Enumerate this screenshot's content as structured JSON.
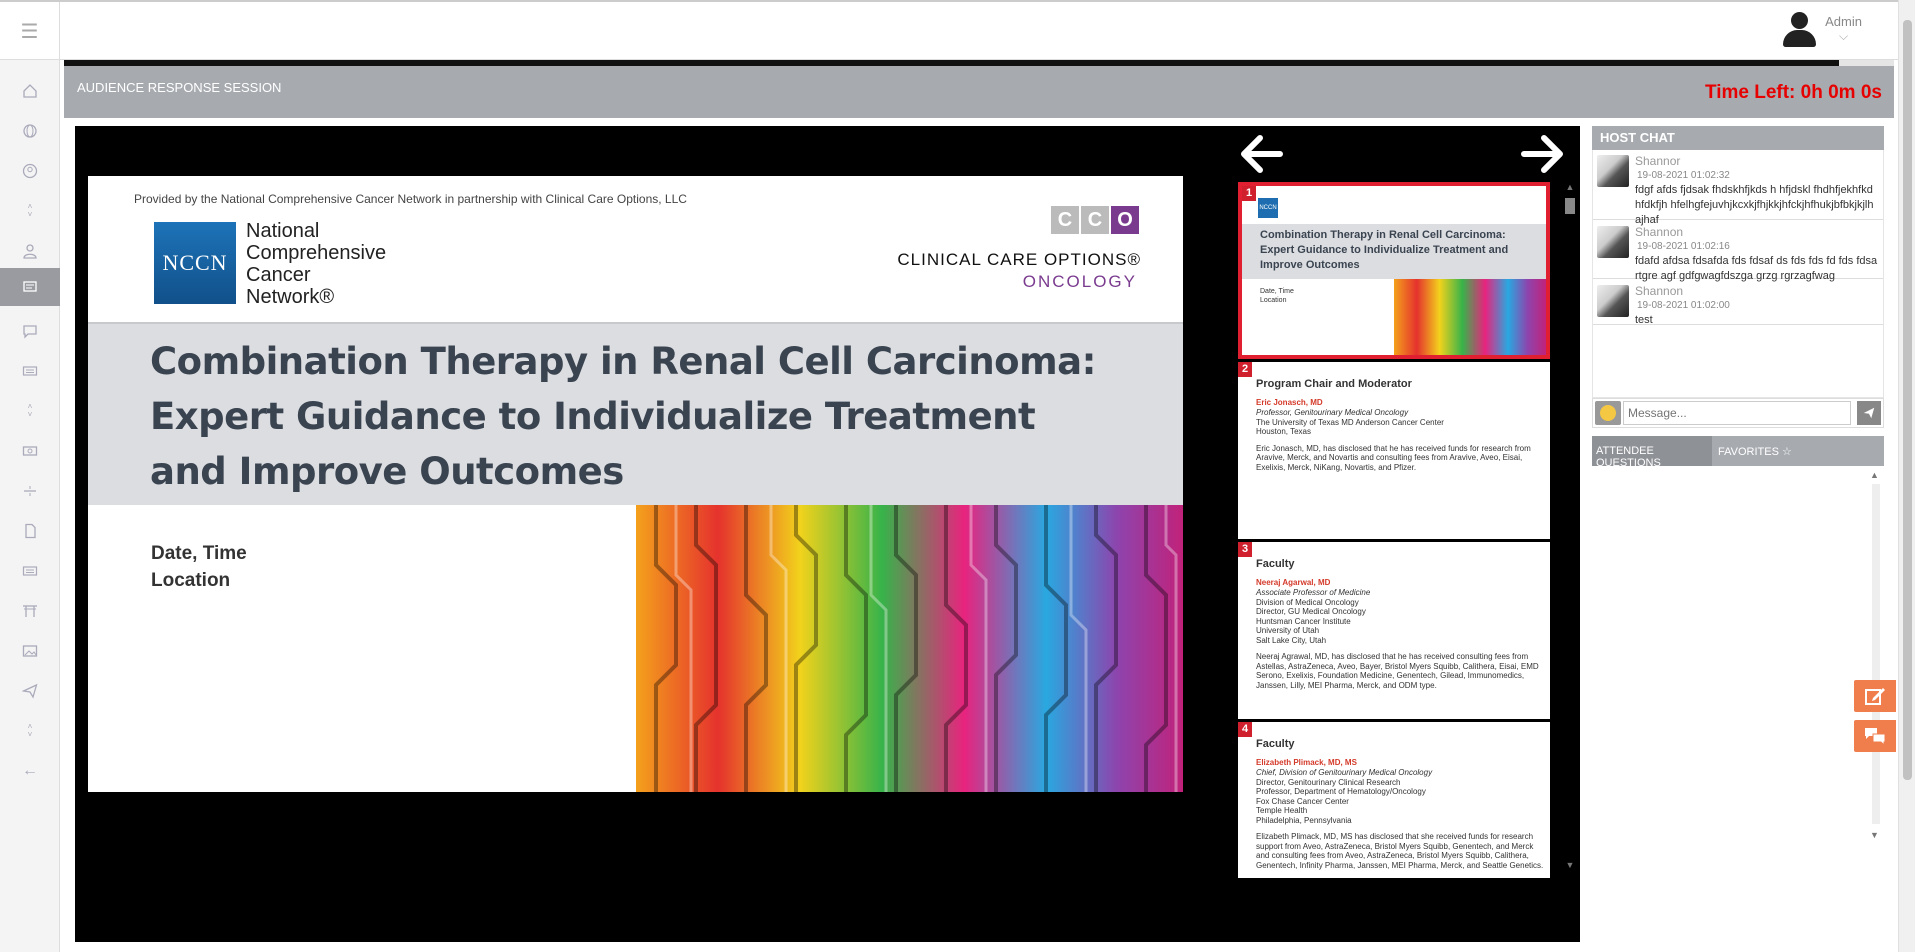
{
  "header": {
    "menu_icon": "hamburger-icon",
    "user_name": "Admin",
    "user_icon": "user-icon",
    "chevron": "⌵"
  },
  "sidebar": {
    "items": [
      {
        "icon": "home-icon"
      },
      {
        "icon": "globe-icon"
      },
      {
        "icon": "user-circle-icon"
      },
      {
        "icon": "arrows-vertical-icon"
      },
      {
        "icon": "user-icon"
      },
      {
        "icon": "presentation-icon",
        "active": true
      },
      {
        "icon": "chat-icon"
      },
      {
        "icon": "keyboard-icon"
      },
      {
        "icon": "arrows-vertical-icon"
      },
      {
        "icon": "money-icon"
      },
      {
        "icon": "divider-icon"
      },
      {
        "icon": "document-icon"
      },
      {
        "icon": "keyboard-icon"
      },
      {
        "icon": "gate-icon"
      },
      {
        "icon": "image-icon"
      },
      {
        "icon": "send-icon"
      },
      {
        "icon": "arrows-vertical-icon"
      },
      {
        "icon": "back-arrow-icon"
      }
    ]
  },
  "session": {
    "title": "AUDIENCE RESPONSE SESSION",
    "time_left": "Time Left: 0h 0m 0s",
    "progress": 0.97
  },
  "slide": {
    "provided_by": "Provided by the National Comprehensive Cancer Network in partnership with Clinical Care Options, LLC",
    "nccn_logo": "NCCN",
    "nccn_name": [
      "National",
      "Comprehensive",
      "Cancer",
      "Network®"
    ],
    "cco_letters": [
      "C",
      "C",
      "O"
    ],
    "cco_name": "CLINICAL CARE OPTIONS®",
    "cco_sub": "ONCOLOGY",
    "title": "Combination Therapy in Renal Cell Carcinoma: Expert Guidance to Individualize Treatment and Improve Outcomes",
    "date_line1": "Date, Time",
    "date_line2": "Location"
  },
  "thumbnails": [
    {
      "number": "1",
      "title": "Combination Therapy in Renal Cell Carcinoma: Expert Guidance to Individualize Treatment and Improve Outcomes",
      "lines": [
        "Date, Time",
        "Location"
      ]
    },
    {
      "number": "2",
      "title": "Program Chair and Moderator",
      "lines": [
        {
          "text": "Eric Jonasch, MD",
          "style": "red"
        },
        {
          "text": "Professor, Genitourinary Medical Oncology",
          "style": "i"
        },
        {
          "text": "The University of Texas MD Anderson Cancer Center",
          "style": ""
        },
        {
          "text": "Houston, Texas",
          "style": ""
        },
        {
          "text": "Eric Jonasch, MD, has disclosed that he has received funds for research from",
          "style": ""
        },
        {
          "text": "Aravive, Merck, and Novartis and consulting fees from Aravive, Aveo, Eisai,",
          "style": ""
        },
        {
          "text": "Exelixis, Merck, NiKang, Novartis, and Pfizer.",
          "style": ""
        }
      ]
    },
    {
      "number": "3",
      "title": "Faculty",
      "lines": [
        {
          "text": "Neeraj Agarwal, MD",
          "style": "red"
        },
        {
          "text": "Associate Professor of Medicine",
          "style": "i"
        },
        {
          "text": "Division of Medical Oncology",
          "style": ""
        },
        {
          "text": "Director, GU Medical Oncology",
          "style": ""
        },
        {
          "text": "Huntsman Cancer Institute",
          "style": ""
        },
        {
          "text": "University of Utah",
          "style": ""
        },
        {
          "text": "Salt Lake City, Utah",
          "style": ""
        },
        {
          "text": "Neeraj Agrawal, MD, has disclosed that he has received consulting fees from",
          "style": ""
        },
        {
          "text": "Astellas, AstraZeneca, Aveo, Bayer, Bristol Myers Squibb, Calithera, Eisai, EMD",
          "style": ""
        },
        {
          "text": "Serono, Exelixis, Foundation Medicine, Genentech, Gilead, Immunomedics,",
          "style": ""
        },
        {
          "text": "Janssen, Lilly, MEI Pharma, Merck, and ODM type.",
          "style": ""
        }
      ]
    },
    {
      "number": "4",
      "title": "Faculty",
      "lines": [
        {
          "text": "Elizabeth Plimack, MD, MS",
          "style": "red"
        },
        {
          "text": "Chief, Division of Genitourinary Medical Oncology",
          "style": "i"
        },
        {
          "text": "Director, Genitourinary Clinical Research",
          "style": ""
        },
        {
          "text": "Professor, Department of Hematology/Oncology",
          "style": ""
        },
        {
          "text": "Fox Chase Cancer Center",
          "style": ""
        },
        {
          "text": "Temple Health",
          "style": ""
        },
        {
          "text": "Philadelphia, Pennsylvania",
          "style": ""
        },
        {
          "text": "Elizabeth Plimack, MD, MS has disclosed that she received funds for research",
          "style": ""
        },
        {
          "text": "support from Aveo, AstraZeneca, Bristol Myers Squibb, Genentech, and Merck",
          "style": ""
        },
        {
          "text": "and consulting fees from Aveo, AstraZeneca, Bristol Myers Squibb, Calithera,",
          "style": ""
        },
        {
          "text": "Genentech, Infinity Pharma, Janssen, MEI Pharma, Merck, and Seattle Genetics.",
          "style": ""
        }
      ]
    }
  ],
  "chat": {
    "header": "HOST CHAT",
    "messages": [
      {
        "name": "Shannor",
        "time": "19-08-2021 01:02:32",
        "text": "fdgf afds fjdsak fhdskhfjkds h hfjdskl fhdhfjekhfkd hfdkfjh hfelhgfejuvhjkcxkjfhjkkjhfckjhfhukjbfbkjkjlhajhaf"
      },
      {
        "name": "Shannon",
        "time": "19-08-2021 01:02:16",
        "text": "fdafd afdsa fdsafda fds fdsaf ds fds fds fd fds fdsa rtgre agf gdfgwagfdszga grzg rgrzagfwag"
      },
      {
        "name": "Shannon",
        "time": "19-08-2021 01:02:00",
        "text": "test"
      }
    ],
    "input_placeholder": "Message...",
    "send_icon": "send-icon",
    "emoji_icon": "emoji-icon"
  },
  "tabs": {
    "attendee_questions": "ATTENDEE QUESTIONS",
    "favorites": "FAVORITES ☆"
  },
  "floating": {
    "edit_icon": "edit-icon",
    "chat_icon": "chat-bubbles-icon"
  }
}
